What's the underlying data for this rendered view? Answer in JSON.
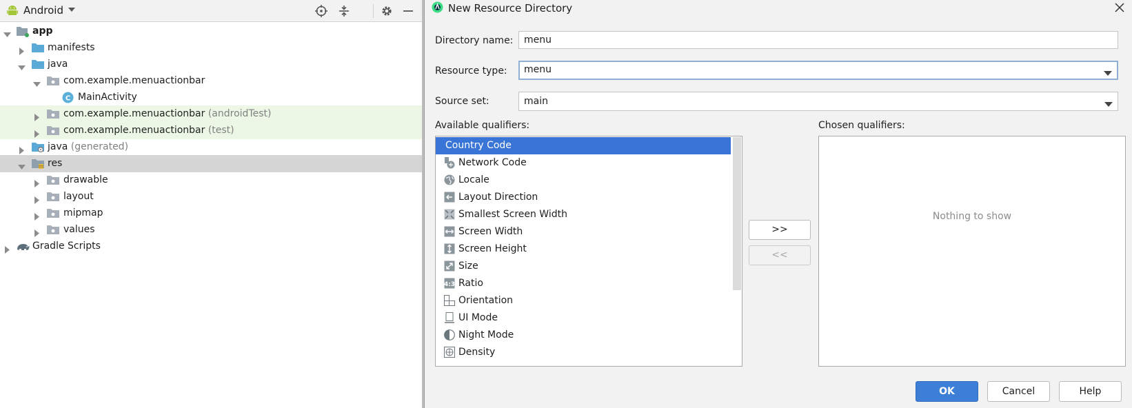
{
  "project_panel": {
    "view_selector": "Android",
    "tree": [
      {
        "label": "app",
        "bold": true
      },
      {
        "label": "manifests"
      },
      {
        "label": "java"
      },
      {
        "label": "com.example.menuactionbar"
      },
      {
        "label": "MainActivity"
      },
      {
        "label": "com.example.menuactionbar",
        "suffix": "(androidTest)"
      },
      {
        "label": "com.example.menuactionbar",
        "suffix": "(test)"
      },
      {
        "label": "java",
        "suffix": "(generated)"
      },
      {
        "label": "res"
      },
      {
        "label": "drawable"
      },
      {
        "label": "layout"
      },
      {
        "label": "mipmap"
      },
      {
        "label": "values"
      },
      {
        "label": "Gradle Scripts"
      }
    ]
  },
  "dialog": {
    "title": "New Resource Directory",
    "directory_name": {
      "label": "Directory name:",
      "value": "menu"
    },
    "resource_type": {
      "label": "Resource type:",
      "value": "menu"
    },
    "source_set": {
      "label": "Source set:",
      "value": "main"
    },
    "available_label": "Available qualifiers:",
    "chosen_label": "Chosen qualifiers:",
    "available_qualifiers": [
      {
        "label": "Country Code",
        "icon": "country-code-icon",
        "selected": true
      },
      {
        "label": "Network Code",
        "icon": "network-code-icon"
      },
      {
        "label": "Locale",
        "icon": "globe-icon"
      },
      {
        "label": "Layout Direction",
        "icon": "layout-direction-icon"
      },
      {
        "label": "Smallest Screen Width",
        "icon": "smallest-width-icon"
      },
      {
        "label": "Screen Width",
        "icon": "screen-width-icon"
      },
      {
        "label": "Screen Height",
        "icon": "screen-height-icon"
      },
      {
        "label": "Size",
        "icon": "size-icon"
      },
      {
        "label": "Ratio",
        "icon": "ratio-icon"
      },
      {
        "label": "Orientation",
        "icon": "orientation-icon"
      },
      {
        "label": "UI Mode",
        "icon": "ui-mode-icon"
      },
      {
        "label": "Night Mode",
        "icon": "night-mode-icon"
      },
      {
        "label": "Density",
        "icon": "density-icon"
      }
    ],
    "chosen_empty_text": "Nothing to show",
    "add_button": ">>",
    "remove_button": "<<",
    "ok_button": "OK",
    "cancel_button": "Cancel",
    "help_button": "Help"
  },
  "colors": {
    "selection": "#3875d7",
    "test_source_highlight": "#edf7e6",
    "folder": "#5aa9d6",
    "android_green": "#a4c639"
  }
}
